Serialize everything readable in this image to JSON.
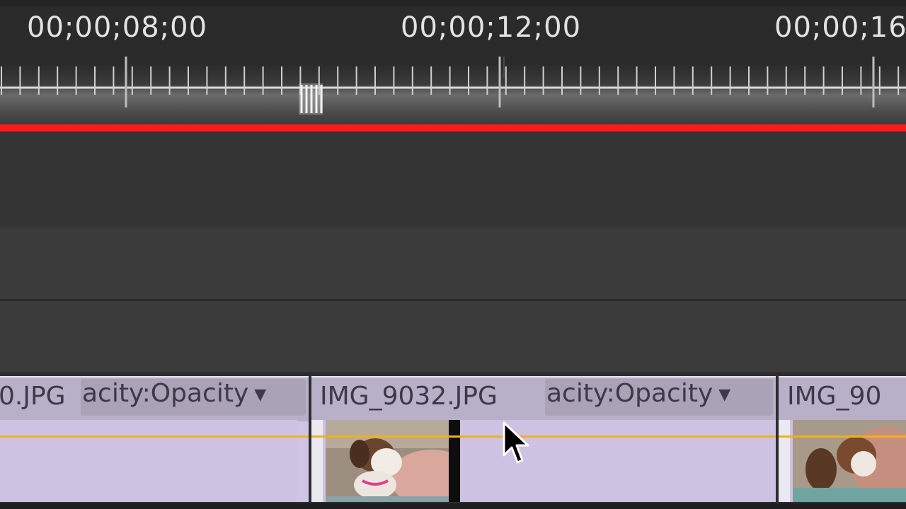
{
  "ruler": {
    "timecodes": [
      "00;00;08;00",
      "00;00;12;00",
      "00;00;16"
    ]
  },
  "clips": [
    {
      "name": "0.JPG",
      "effect": "acity:Opacity"
    },
    {
      "name": "IMG_9032.JPG",
      "effect": "acity:Opacity"
    },
    {
      "name": "IMG_90",
      "effect": ""
    }
  ],
  "icons": {
    "effect_dropdown": "triangle-down-icon",
    "mouse_cursor": "arrow-pointer-icon"
  },
  "colors": {
    "work_area_bar": "#ff1a1a",
    "clip_fill": "#cdc2e2",
    "opacity_keyline": "#f0b020"
  }
}
